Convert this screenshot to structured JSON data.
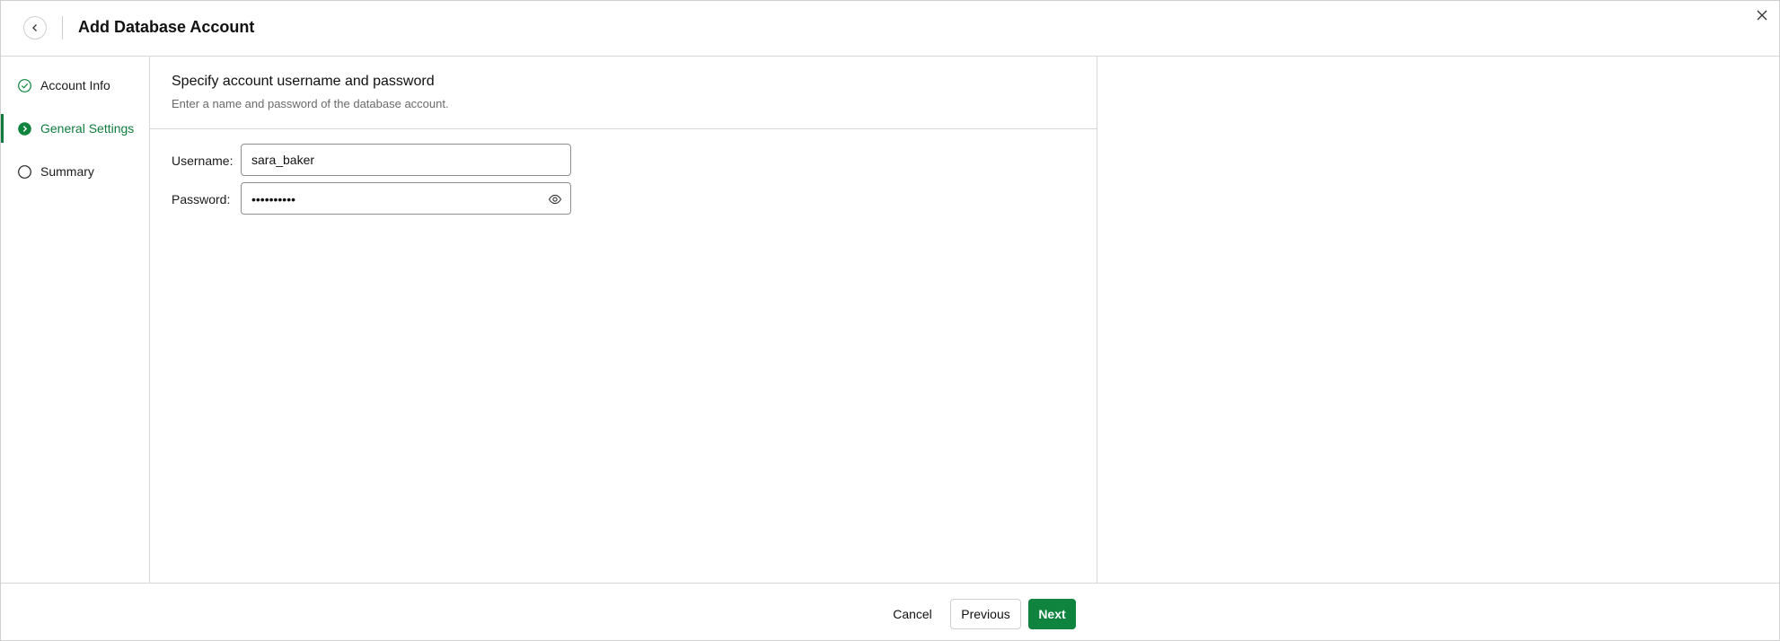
{
  "header": {
    "title": "Add Database Account",
    "back_icon": "chevron-left-icon",
    "close_icon": "close-icon"
  },
  "steps": [
    {
      "label": "Account Info",
      "state": "completed"
    },
    {
      "label": "General Settings",
      "state": "active"
    },
    {
      "label": "Summary",
      "state": "pending"
    }
  ],
  "main": {
    "section_title": "Specify account username and password",
    "section_subtitle": "Enter a name and password of the database account.",
    "username_label": "Username:",
    "username_value": "sara_baker",
    "password_label": "Password:",
    "password_masked": "••••••••••"
  },
  "footer": {
    "cancel_label": "Cancel",
    "previous_label": "Previous",
    "next_label": "Next"
  },
  "colors": {
    "accent": "#0e843f",
    "border": "#d6d6d6",
    "muted_text": "#6b6b6b"
  }
}
